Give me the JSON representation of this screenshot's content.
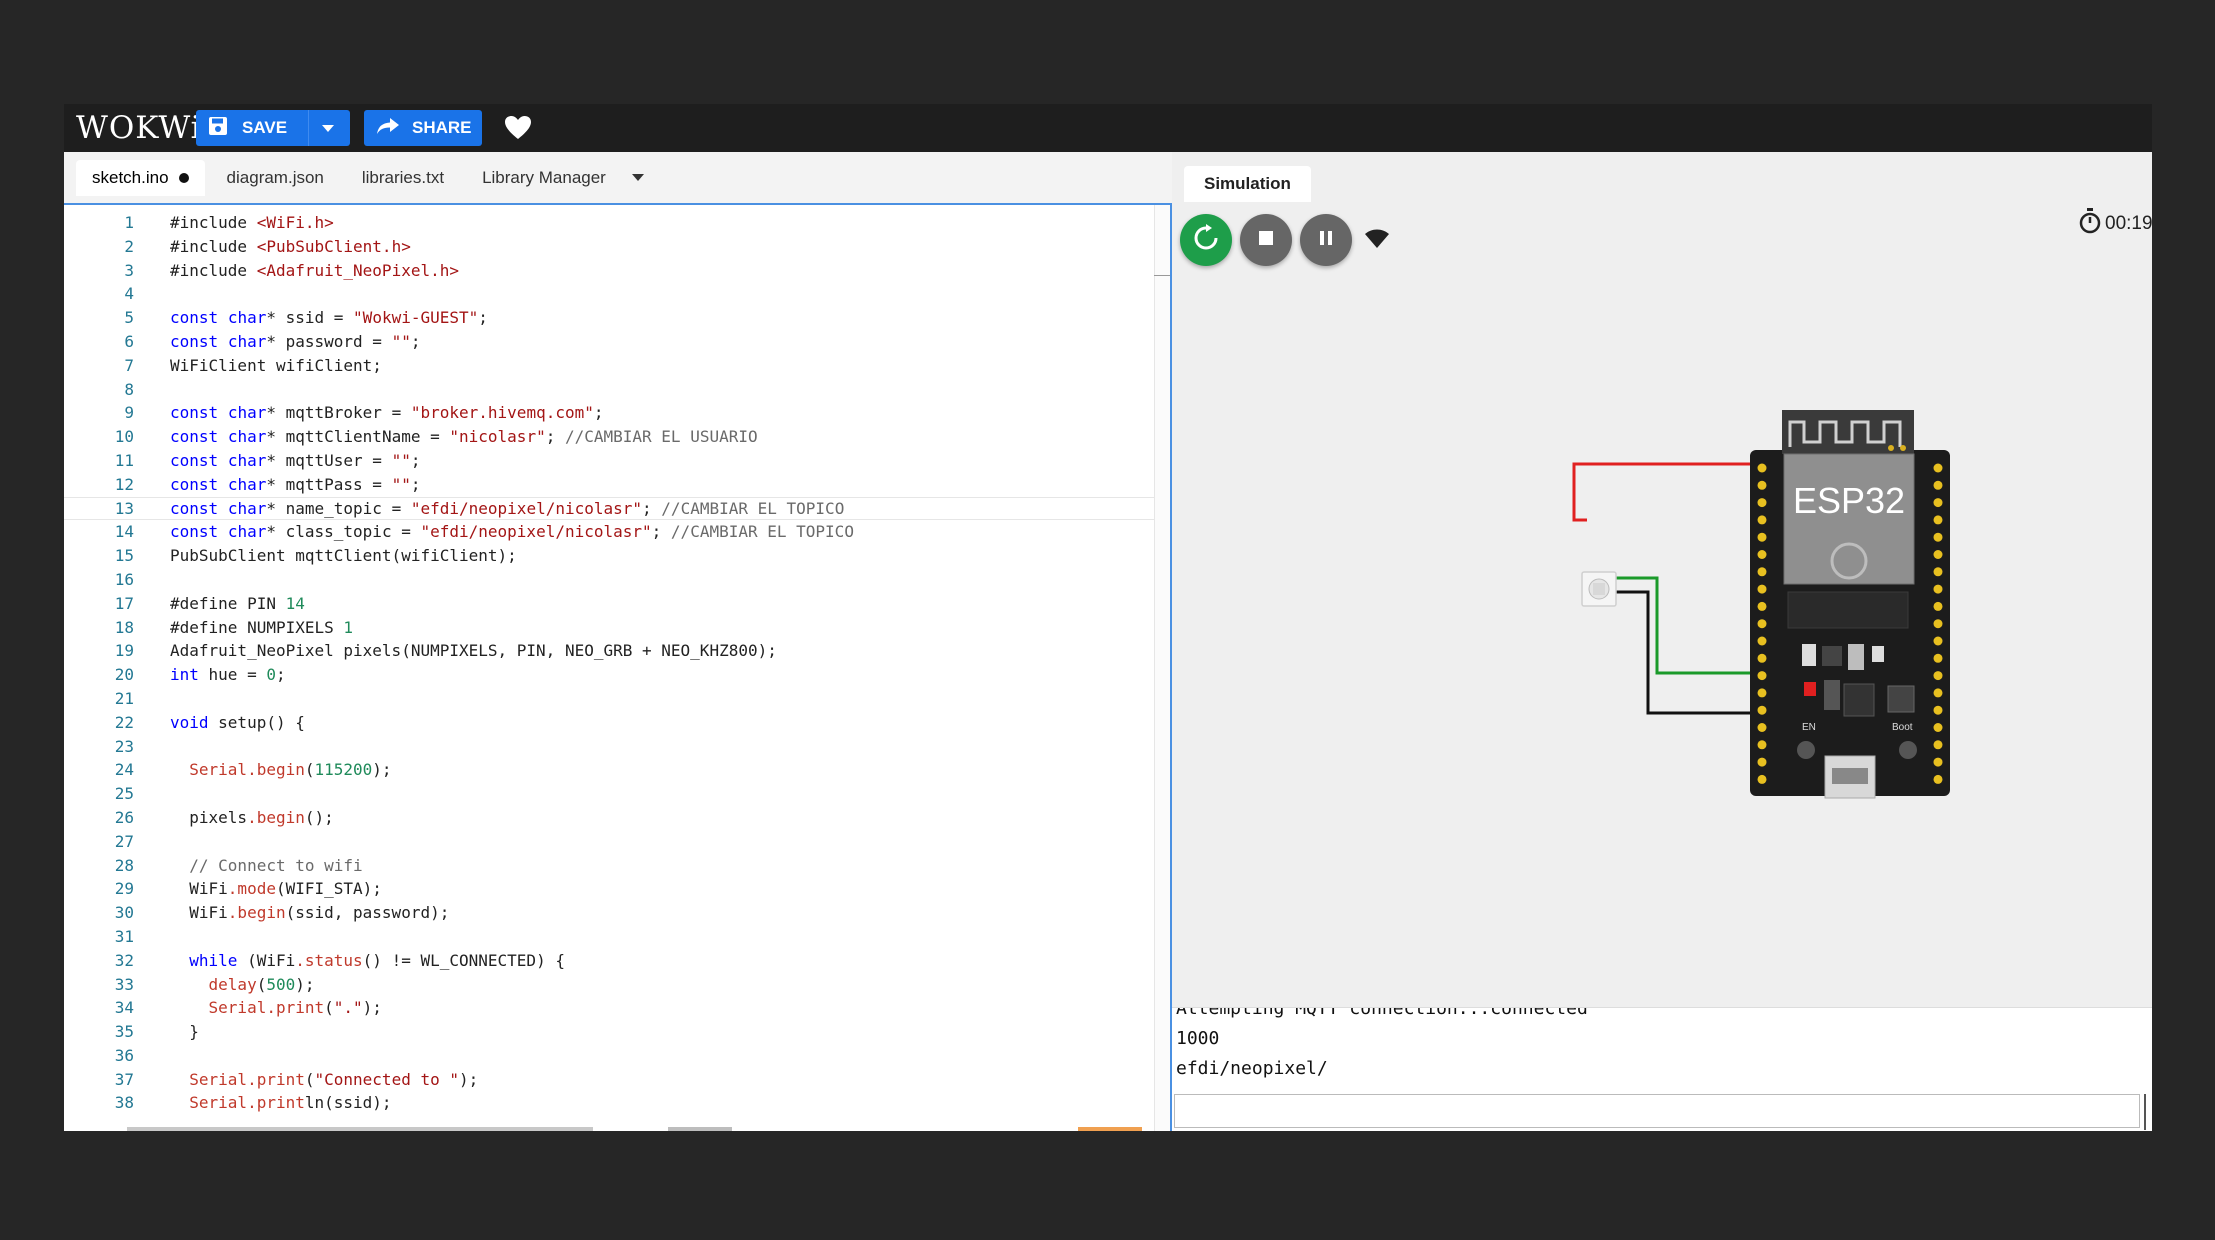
{
  "header": {
    "logo": "WOKWi",
    "save_label": "SAVE",
    "share_label": "SHARE"
  },
  "editor": {
    "tabs": [
      {
        "label": "sketch.ino",
        "modified": true
      },
      {
        "label": "diagram.json"
      },
      {
        "label": "libraries.txt"
      },
      {
        "label": "Library Manager"
      }
    ]
  },
  "code_lines": [
    "#include <WiFi.h>",
    "#include <PubSubClient.h>",
    "#include <Adafruit_NeoPixel.h>",
    "",
    "const char* ssid = \"Wokwi-GUEST\";",
    "const char* password = \"\";",
    "WiFiClient wifiClient;",
    "",
    "const char* mqttBroker = \"broker.hivemq.com\";",
    "const char* mqttClientName = \"nicolasr\"; //CAMBIAR EL USUARIO",
    "const char* mqttUser = \"\";",
    "const char* mqttPass = \"\";",
    "const char* name_topic = \"efdi/neopixel/nicolasr\"; //CAMBIAR EL TOPICO",
    "const char* class_topic = \"efdi/neopixel/nicolasr\"; //CAMBIAR EL TOPICO",
    "PubSubClient mqttClient(wifiClient);",
    "",
    "#define PIN 14",
    "#define NUMPIXELS 1",
    "Adafruit_NeoPixel pixels(NUMPIXELS, PIN, NEO_GRB + NEO_KHZ800);",
    "int hue = 0;",
    "",
    "void setup() {",
    "",
    "  Serial.begin(115200);",
    "",
    "  pixels.begin();",
    "",
    "  // Connect to wifi",
    "  WiFi.mode(WIFI_STA);",
    "  WiFi.begin(ssid, password);",
    "",
    "  while (WiFi.status() != WL_CONNECTED) {",
    "    delay(500);",
    "    Serial.print(\".\");",
    "  }",
    "",
    "  Serial.print(\"Connected to \");",
    "  Serial.println(ssid);"
  ],
  "highlighted_line": 13,
  "simulation": {
    "tab_label": "Simulation",
    "timer": "00:19",
    "board_label": "ESP32",
    "en_label": "EN",
    "boot_label": "Boot",
    "serial_lines": [
      "Attempting MQTT connection...connected",
      "1000",
      "efdi/neopixel/"
    ]
  },
  "icons": {
    "save": "floppy-disk-icon",
    "save_menu": "chevron-down-icon",
    "share": "share-arrow-icon",
    "like": "heart-icon",
    "restart": "restart-icon",
    "stop": "stop-icon",
    "pause": "pause-icon",
    "wifi": "wifi-icon",
    "timer": "stopwatch-icon"
  },
  "colors": {
    "accent": "#1a73e8",
    "header_bg": "#1e1e1e",
    "restart": "#1e9e4a",
    "wire_red": "#e02020",
    "wire_green": "#1a9a2a",
    "wire_black": "#111111"
  }
}
